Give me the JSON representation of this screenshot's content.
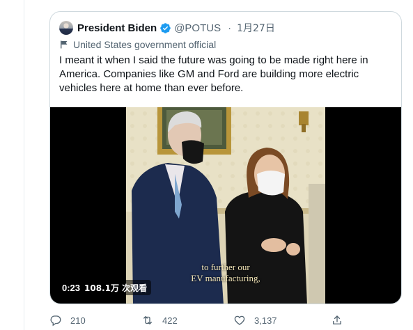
{
  "tweet": {
    "author_name": "President Biden",
    "handle": "@POTUS",
    "separator": "·",
    "date": "1月27日",
    "label": "United States government official",
    "text": "I meant it when I said the future was going to be made right here in America. Companies like GM and Ford are building more electric vehicles here at home than ever before."
  },
  "media": {
    "caption_line1": "to further our",
    "caption_line2": "EV manufacturing,",
    "duration": "0:23",
    "views": "108.1万 次观看"
  },
  "actions": {
    "replies": "210",
    "retweets": "422",
    "likes": "3,137"
  },
  "colors": {
    "verified_badge": "#1d9bf0",
    "secondary_text": "#536471",
    "border": "#cfd9de"
  }
}
